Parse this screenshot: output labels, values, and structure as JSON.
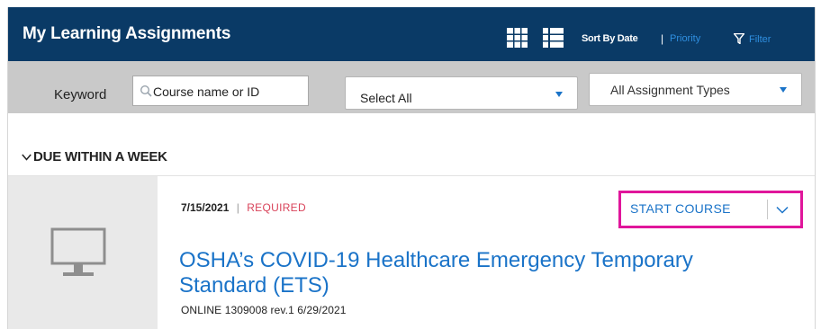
{
  "header": {
    "title": "My Learning Assignments",
    "sort_by_date": "Sort By Date",
    "separator": "|",
    "priority": "Priority",
    "filter": "Filter"
  },
  "toolbar": {
    "keyword_label": "Keyword",
    "keyword_placeholder": "Course name or ID",
    "select_status": "Select All",
    "select_types": "All Assignment Types"
  },
  "section": {
    "label": "DUE WITHIN A WEEK"
  },
  "course": {
    "date": "7/15/2021",
    "separator": "|",
    "required": "REQUIRED",
    "start_label": "START COURSE",
    "title": "OSHA’s COVID-19 Healthcare Emergency Temporary Standard (ETS)",
    "subtitle": "ONLINE 1309008 rev.1 6/29/2021",
    "thumb_icon": "monitor-icon"
  },
  "colors": {
    "header_bg": "#0a3a66",
    "toolbar_bg": "#c9c9c9",
    "link_blue": "#1a73c8",
    "required_red": "#d9435a",
    "highlight_magenta": "#e0169b"
  }
}
